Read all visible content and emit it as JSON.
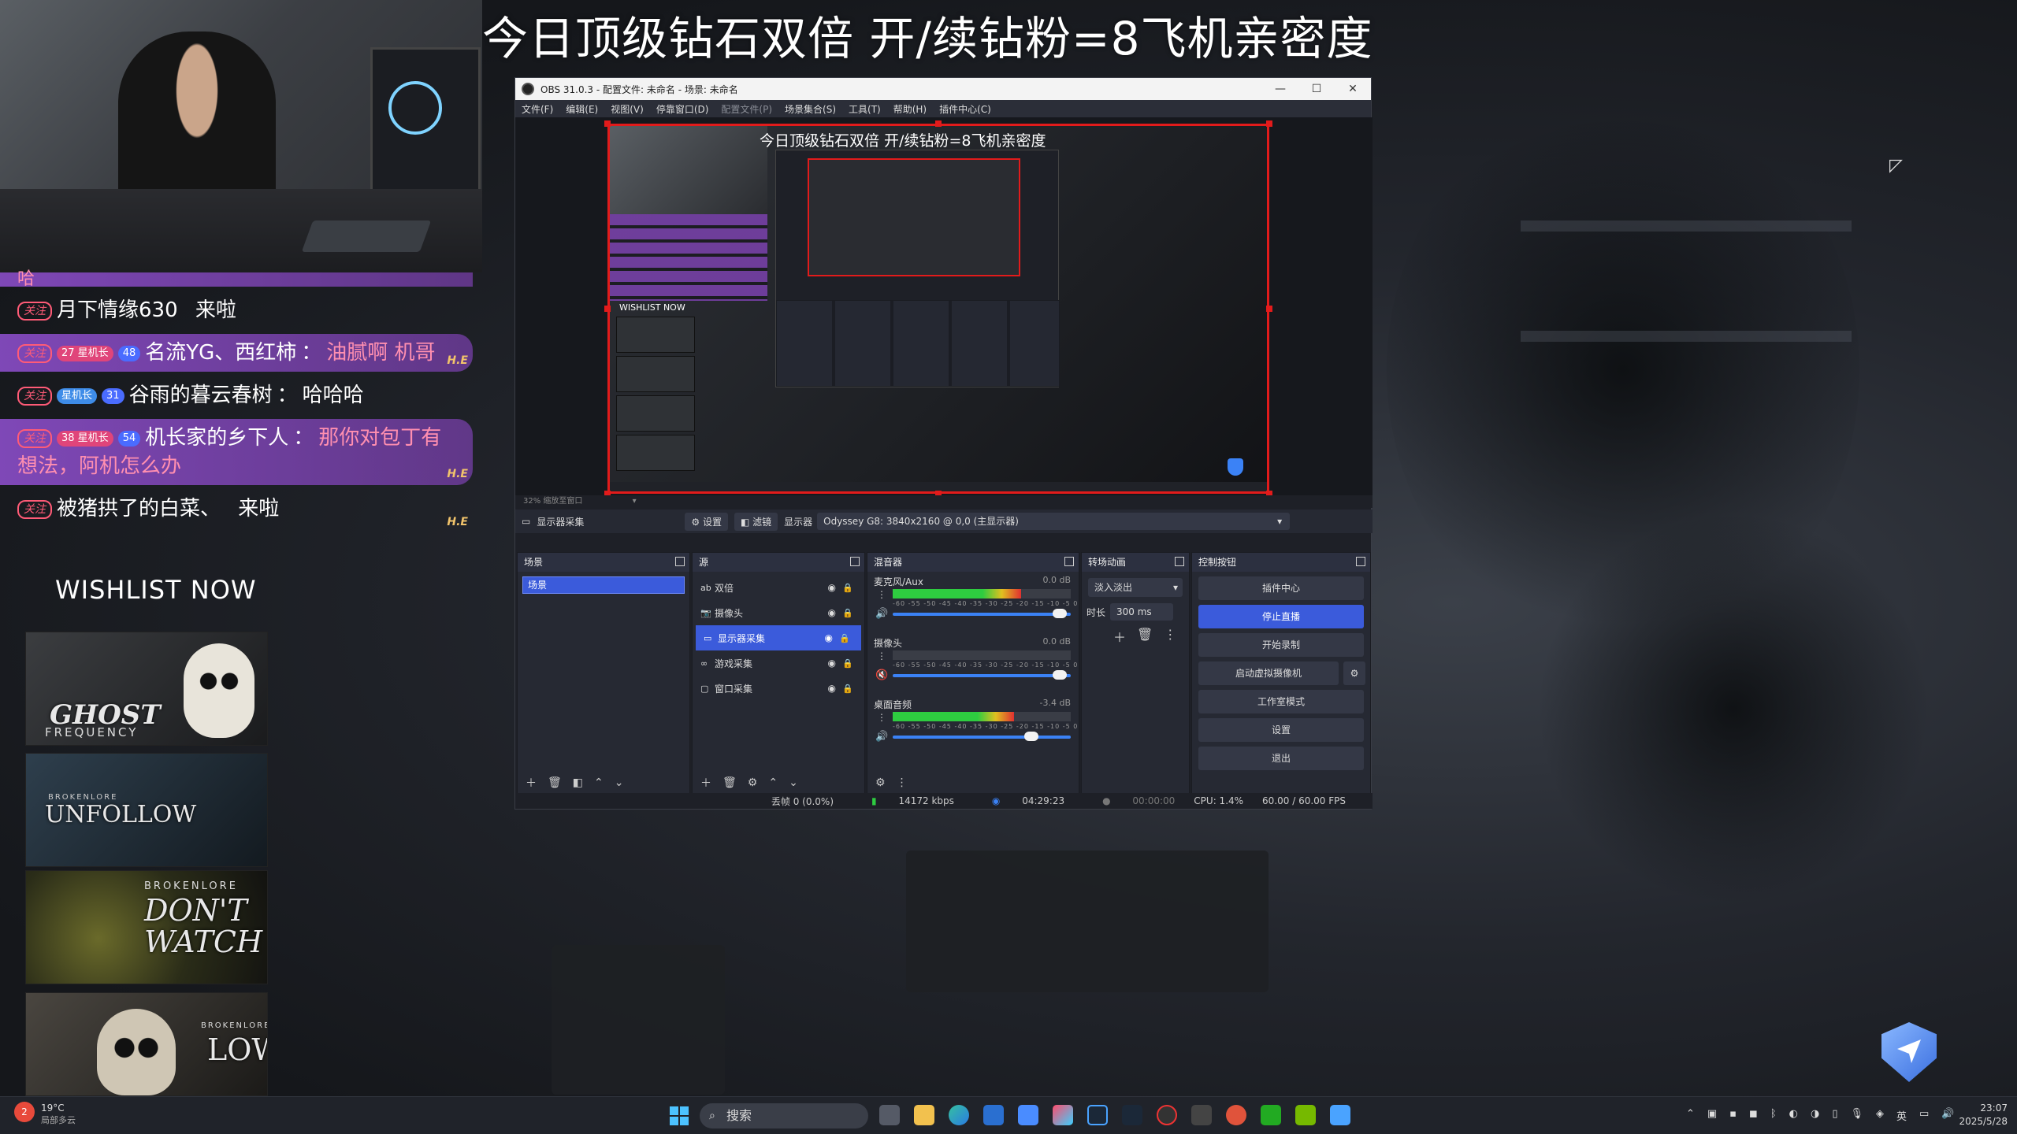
{
  "stream": {
    "title": "今日顶级钻石双倍 开/续钻粉=8飞机亲密度"
  },
  "chat": {
    "partial_top": "哈",
    "fan_badge": "关注",
    "he_tag": "H.E",
    "lines": [
      {
        "user": "月下情缘630",
        "msg": "来啦",
        "highlight": false,
        "badges": []
      },
      {
        "user": "名流YG、西红柿",
        "sep": "：",
        "msg": "油腻啊 机哥",
        "highlight": true,
        "badges": [
          {
            "text": "27 星机长",
            "style": "pink"
          },
          {
            "text": "48",
            "style": "blue"
          }
        ]
      },
      {
        "user": "谷雨的暮云春树",
        "sep": "：",
        "msg": "哈哈哈",
        "highlight": false,
        "badges": [
          {
            "text": "星机长",
            "style": "blue2"
          },
          {
            "text": "31",
            "style": "blue"
          }
        ]
      },
      {
        "user": "机长家的乡下人",
        "sep": "：",
        "msg": "那你对包丁有想法，阿机怎么办",
        "highlight": true,
        "badges": [
          {
            "text": "38 星机长",
            "style": "pink"
          },
          {
            "text": "54",
            "style": "blue"
          }
        ]
      },
      {
        "user": "被猪拱了的白菜、",
        "msg": "来啦",
        "highlight": false,
        "badges": []
      }
    ]
  },
  "wishlist": {
    "heading": "WISHLIST NOW",
    "games": [
      {
        "title": "GHOST",
        "sub": "FREQUENCY"
      },
      {
        "title": "UNFOLLOW",
        "sub": "BROKENLORE"
      },
      {
        "title": "DON'T WATCH",
        "sub": "BROKENLORE"
      },
      {
        "title": "LOW",
        "sub": "BROKENLORE"
      }
    ]
  },
  "obs": {
    "window_title": "OBS 31.0.3 - 配置文件: 未命名 - 场景: 未命名",
    "window_controls": [
      "—",
      "☐",
      "✕"
    ],
    "menu": [
      {
        "label": "文件(F)",
        "dim": false
      },
      {
        "label": "编辑(E)",
        "dim": false
      },
      {
        "label": "视图(V)",
        "dim": false
      },
      {
        "label": "停靠窗口(D)",
        "dim": false
      },
      {
        "label": "配置文件(P)",
        "dim": true
      },
      {
        "label": "场景集合(S)",
        "dim": false
      },
      {
        "label": "工具(T)",
        "dim": false
      },
      {
        "label": "帮助(H)",
        "dim": false
      },
      {
        "label": "插件中心(C)",
        "dim": false
      }
    ],
    "preview_title": "今日顶级钻石双倍 开/续钻粉=8飞机亲密度",
    "preview_wishlist": "WISHLIST NOW",
    "zoom_label": "32%   缩放至窗口",
    "toolbar": {
      "source_name": "显示器采集",
      "settings": "设置",
      "filters": "滤镜",
      "display_label": "显示器",
      "display_value": "Odyssey G8: 3840x2160 @ 0,0 (主显示器)"
    },
    "scenes": {
      "header": "场景",
      "items": [
        "场景"
      ]
    },
    "sources": {
      "header": "源",
      "items": [
        {
          "icon": "ab",
          "name": "双倍",
          "selected": false
        },
        {
          "icon": "📷",
          "name": "摄像头",
          "selected": false
        },
        {
          "icon": "▭",
          "name": "显示器采集",
          "selected": true
        },
        {
          "icon": "∞",
          "name": "游戏采集",
          "selected": false
        },
        {
          "icon": "▢",
          "name": "窗口采集",
          "selected": false
        }
      ]
    },
    "mixer": {
      "header": "混音器",
      "scale": "-60 -55 -50 -45 -40 -35 -30 -25 -20 -15 -10 -5 0",
      "channels": [
        {
          "name": "麦克风/Aux",
          "db": "0.0 dB",
          "level": 0.72,
          "fader": 0.98,
          "muted": false
        },
        {
          "name": "摄像头",
          "db": "0.0 dB",
          "level": 0.0,
          "fader": 0.98,
          "muted": true
        },
        {
          "name": "桌面音频",
          "db": "-3.4 dB",
          "level": 0.68,
          "fader": 0.82,
          "muted": false
        }
      ]
    },
    "transitions": {
      "header": "转场动画",
      "selected": "淡入淡出",
      "duration_label": "时长",
      "duration_value": "300 ms"
    },
    "controls": {
      "header": "控制按钮",
      "buttons": [
        {
          "label": "插件中心",
          "active": false
        },
        {
          "label": "停止直播",
          "active": true
        },
        {
          "label": "开始录制",
          "active": false
        },
        {
          "label": "启动虚拟摄像机",
          "active": false
        },
        {
          "label": "工作室模式",
          "active": false
        },
        {
          "label": "设置",
          "active": false
        },
        {
          "label": "退出",
          "active": false
        }
      ]
    },
    "status": {
      "dropped": "丢帧 0 (0.0%)",
      "bitrate": "14172 kbps",
      "stream_time": "04:29:23",
      "rec_time": "00:00:00",
      "cpu": "CPU: 1.4%",
      "fps": "60.00 / 60.00 FPS"
    }
  },
  "taskbar": {
    "weather_temp": "19°C",
    "weather_desc": "局部多云",
    "weather_badge": "2",
    "search_placeholder": "搜索",
    "tray_lang": "英",
    "clock_time": "23:07",
    "clock_date": "2025/5/28"
  },
  "colors": {
    "accent": "#3b5bdb",
    "preview_border": "#e21b1b",
    "chat_highlight": "#9150d2",
    "chat_highlight_text": "#ff8fb0"
  }
}
